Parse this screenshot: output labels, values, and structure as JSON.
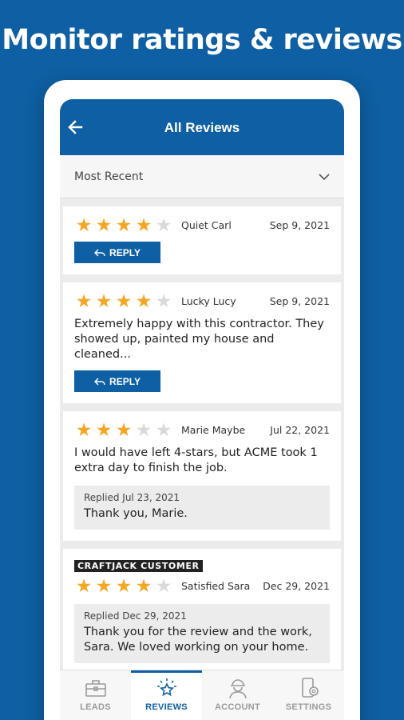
{
  "promo": {
    "title": "Monitor ratings & reviews"
  },
  "appbar": {
    "title": "All Reviews"
  },
  "sort": {
    "selected": "Most Recent"
  },
  "reviews": [
    {
      "rating": 4,
      "name": "Quiet Carl",
      "date": "Sep 9, 2021",
      "text": "",
      "reply_label": "REPLY"
    },
    {
      "rating": 4,
      "name": "Lucky Lucy",
      "date": "Sep 9, 2021",
      "text": "Extremely happy with this contractor. They showed up, painted my house and cleaned...",
      "reply_label": "REPLY"
    },
    {
      "rating": 3,
      "name": "Marie Maybe",
      "date": "Jul 22, 2021",
      "text": "I would have left 4-stars, but ACME took 1 extra day to finish the job.",
      "reply_date": "Replied Jul 23, 2021",
      "reply_text": "Thank you, Marie."
    },
    {
      "badge": "CRAFTJACK CUSTOMER",
      "rating": 4,
      "name": "Satisfied Sara",
      "date": "Dec 29, 2021",
      "reply_date": "Replied Dec 29, 2021",
      "reply_text": "Thank you for the review and the work, Sara. We loved working on your home."
    }
  ],
  "nav": [
    {
      "label": "LEADS",
      "icon": "toolbox-icon"
    },
    {
      "label": "REVIEWS",
      "icon": "star-icon",
      "active": true
    },
    {
      "label": "ACCOUNT",
      "icon": "worker-icon"
    },
    {
      "label": "SETTINGS",
      "icon": "phone-gear-icon"
    }
  ],
  "colors": {
    "brand": "#0e5fa3",
    "star": "#f5a623"
  }
}
